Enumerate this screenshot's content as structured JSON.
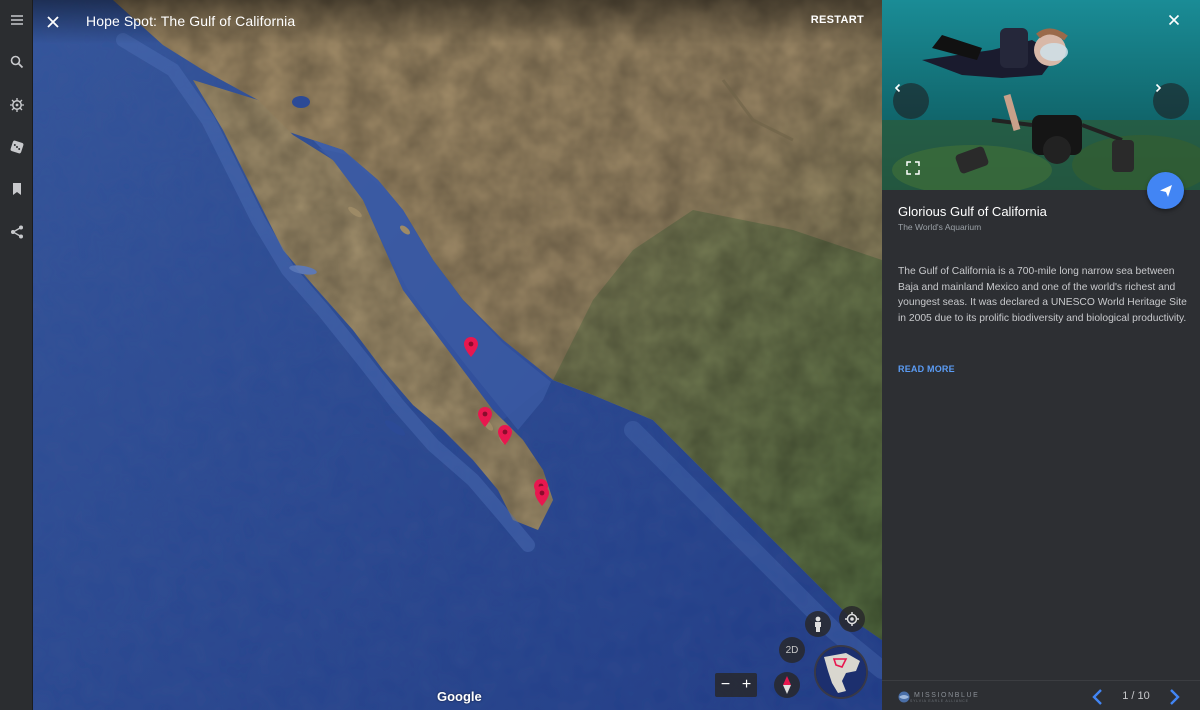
{
  "sidebar": {
    "items": [
      {
        "icon": "menu-icon",
        "label": "Menu"
      },
      {
        "icon": "search-icon",
        "label": "Search"
      },
      {
        "icon": "voyager-wheel-icon",
        "label": "Voyager"
      },
      {
        "icon": "dice-icon",
        "label": "I'm feeling lucky"
      },
      {
        "icon": "bookmark-icon",
        "label": "My Places"
      },
      {
        "icon": "share-icon",
        "label": "Share"
      }
    ]
  },
  "map": {
    "title": "Hope Spot: The Gulf of California",
    "restart_label": "RESTART",
    "attribution": "Google",
    "view_mode_label": "2D",
    "zoom_out_label": "−",
    "zoom_in_label": "+"
  },
  "card": {
    "title": "Glorious Gulf of California",
    "subtitle": "The World's Aquarium",
    "description": "The Gulf of California is a 700-mile long narrow sea between Baja and mainland Mexico and one of the world's richest and youngest seas. It was declared a UNESCO World Heritage Site in 2005 due to its prolific biodiversity and biological productivity.",
    "read_more_label": "READ MORE",
    "footer_logo_text": "MISSIONBLUE",
    "footer_logo_subtext": "SYLVIA EARLE ALLIANCE",
    "pager": "1 / 10"
  },
  "colors": {
    "accent": "#4285f4",
    "pin": "#e8174f",
    "panel": "#2d2f33",
    "rail": "#2b2d30"
  }
}
